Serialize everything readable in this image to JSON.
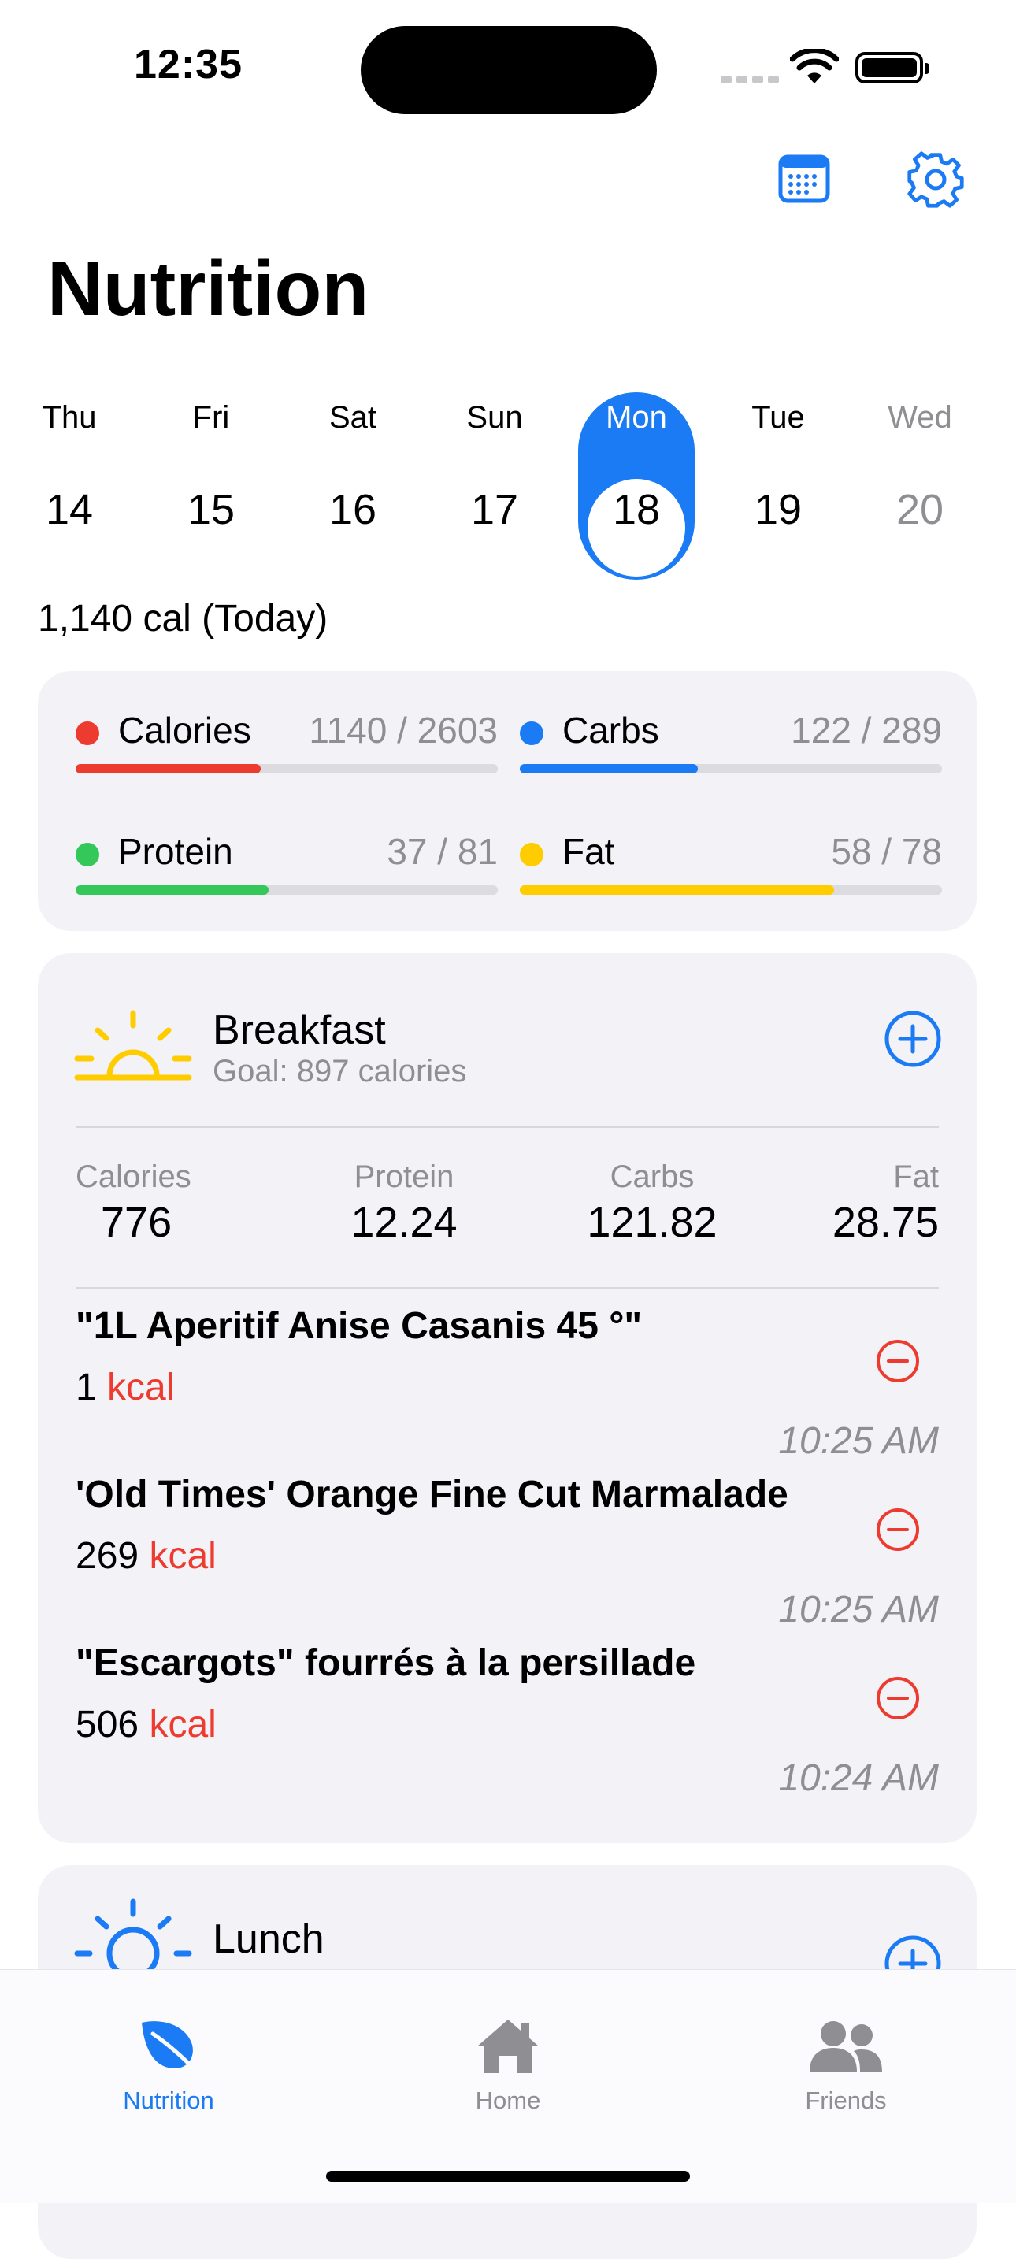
{
  "status_bar": {
    "time": "12:35"
  },
  "header": {
    "title": "Nutrition",
    "calendar_icon": "calendar-icon",
    "settings_icon": "gear-icon"
  },
  "week": [
    {
      "name": "Thu",
      "num": "14"
    },
    {
      "name": "Fri",
      "num": "15"
    },
    {
      "name": "Sat",
      "num": "16"
    },
    {
      "name": "Sun",
      "num": "17"
    },
    {
      "name": "Mon",
      "num": "18",
      "selected": true
    },
    {
      "name": "Tue",
      "num": "19"
    },
    {
      "name": "Wed",
      "num": "20",
      "future": true
    }
  ],
  "today_summary": "1,140 cal (Today)",
  "macros": [
    {
      "label": "Calories",
      "value": "1140 / 2603",
      "fraction": 0.438,
      "color": "#ee3b30"
    },
    {
      "label": "Carbs",
      "value": "122 / 289",
      "fraction": 0.422,
      "color": "#1a7bf5"
    },
    {
      "label": "Protein",
      "value": "37 / 81",
      "fraction": 0.457,
      "color": "#34c759"
    },
    {
      "label": "Fat",
      "value": "58 / 78",
      "fraction": 0.744,
      "color": "#ffcc00"
    }
  ],
  "breakfast": {
    "title": "Breakfast",
    "goal": "Goal: 897 calories",
    "icon": "sunrise-icon",
    "stats": [
      {
        "label": "Calories",
        "value": "776"
      },
      {
        "label": "Protein",
        "value": "12.24"
      },
      {
        "label": "Carbs",
        "value": "121.82"
      },
      {
        "label": "Fat",
        "value": "28.75"
      }
    ],
    "items": [
      {
        "name": "\"1L Aperitif Anise Casanis 45 °\"",
        "calories": "1",
        "unit": "kcal",
        "time": "10:25 AM"
      },
      {
        "name": "'Old Times' Orange Fine Cut Marmalade",
        "calories": "269",
        "unit": "kcal",
        "time": "10:25 AM"
      },
      {
        "name": "\"Escargots\" fourrés à la persillade",
        "calories": "506",
        "unit": "kcal",
        "time": "10:24 AM"
      }
    ]
  },
  "lunch": {
    "title": "Lunch",
    "icon": "sun-icon"
  },
  "tabs": [
    {
      "label": "Nutrition",
      "icon": "leaf-icon",
      "active": true
    },
    {
      "label": "Home",
      "icon": "house-icon"
    },
    {
      "label": "Friends",
      "icon": "people-icon"
    }
  ],
  "colors": {
    "accent": "#1a7bf5",
    "danger": "#ee3b30",
    "sun": "#ffcc00"
  }
}
